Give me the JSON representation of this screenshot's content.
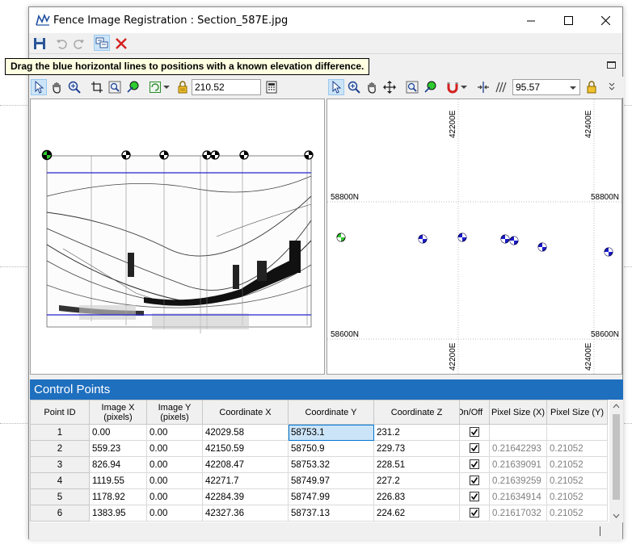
{
  "window": {
    "title": "Fence Image Registration : Section_587E.jpg"
  },
  "hint": {
    "text": "Drag the blue horizontal lines to positions with a known elevation difference."
  },
  "left_toolbar": {
    "scale_value": "210.52"
  },
  "right_toolbar": {
    "zoom_value": "95.57"
  },
  "map": {
    "x_labels": [
      "42200E",
      "42400E"
    ],
    "y_labels": [
      "58800N",
      "58600N"
    ],
    "point_color": "#1a1acc",
    "active_point_color": "#2ecc2e"
  },
  "control_points": {
    "title": "Control Points",
    "columns": [
      "Point ID",
      "Image X\n(pixels)",
      "Image Y\n(pixels)",
      "Coordinate X",
      "Coordinate Y",
      "Coordinate Z",
      "On/Off",
      "Pixel Size (X)",
      "Pixel Size (Y)"
    ],
    "rows": [
      {
        "id": "1",
        "image_x": "0.00",
        "image_y": "0.00",
        "coord_x": "42029.58",
        "coord_y": "58753.1",
        "coord_z": "231.2",
        "on": true,
        "px": "",
        "py": ""
      },
      {
        "id": "2",
        "image_x": "559.23",
        "image_y": "0.00",
        "coord_x": "42150.59",
        "coord_y": "58750.9",
        "coord_z": "229.73",
        "on": true,
        "px": "0.21642293",
        "py": "0.21052"
      },
      {
        "id": "3",
        "image_x": "826.94",
        "image_y": "0.00",
        "coord_x": "42208.47",
        "coord_y": "58753.32",
        "coord_z": "228.51",
        "on": true,
        "px": "0.21639091",
        "py": "0.21052"
      },
      {
        "id": "4",
        "image_x": "1119.55",
        "image_y": "0.00",
        "coord_x": "42271.7",
        "coord_y": "58749.97",
        "coord_z": "227.2",
        "on": true,
        "px": "0.21639259",
        "py": "0.21052"
      },
      {
        "id": "5",
        "image_x": "1178.92",
        "image_y": "0.00",
        "coord_x": "42284.39",
        "coord_y": "58747.99",
        "coord_z": "226.83",
        "on": true,
        "px": "0.21634914",
        "py": "0.21052"
      },
      {
        "id": "6",
        "image_x": "1383.95",
        "image_y": "0.00",
        "coord_x": "42327.36",
        "coord_y": "58737.13",
        "coord_z": "224.62",
        "on": true,
        "px": "0.21617032",
        "py": "0.21052"
      }
    ]
  },
  "icons": {
    "save": "save-icon",
    "undo": "undo-icon",
    "redo": "redo-icon",
    "register": "register-icon",
    "delete": "delete-x-icon",
    "pointer": "pointer-icon",
    "pan": "hand-icon",
    "zoom": "zoom-in-icon",
    "fit": "crop-icon",
    "zoom_box": "zoom-box-icon",
    "add_point": "add-point-icon",
    "refresh": "refresh-icon",
    "lock": "lock-icon",
    "calc": "calculator-icon",
    "move": "move-icon",
    "magnet": "magnet-icon",
    "split": "split-icon"
  }
}
